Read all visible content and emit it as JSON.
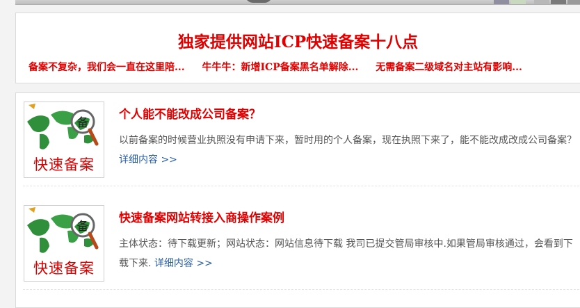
{
  "headline": {
    "title": "独家提供网站ICP快速备案十八点",
    "links": [
      "备案不复杂，我们会一直在这里陪...",
      "牛牛牛：新增ICP备案黑名单解除...",
      "无需备案二级域名对主站有影响..."
    ]
  },
  "articles": [
    {
      "title": "个人能不能改成公司备案？",
      "summary": "以前备案的时候营业执照没有申请下来，暂时用的个人备案，现在执照下来了，能不能改成改成公司备案？",
      "more": "详细内容 >>",
      "thumb_caption": "快速备案",
      "thumb_badge": "备"
    },
    {
      "title": "快速备案网站转接入商操作案例",
      "summary": "主体状态：待下载更新；网站状态：网站信息待下载 我司已提交管局审核中.如果管局审核通过，会看到下载下来.",
      "more": "详细内容 >>",
      "thumb_caption": "快速备案",
      "thumb_badge": "备"
    }
  ],
  "colors": {
    "accent_red": "#e00000",
    "link_blue": "#2a5fa8"
  },
  "icons": [
    "world-map-magnifier-icon"
  ]
}
